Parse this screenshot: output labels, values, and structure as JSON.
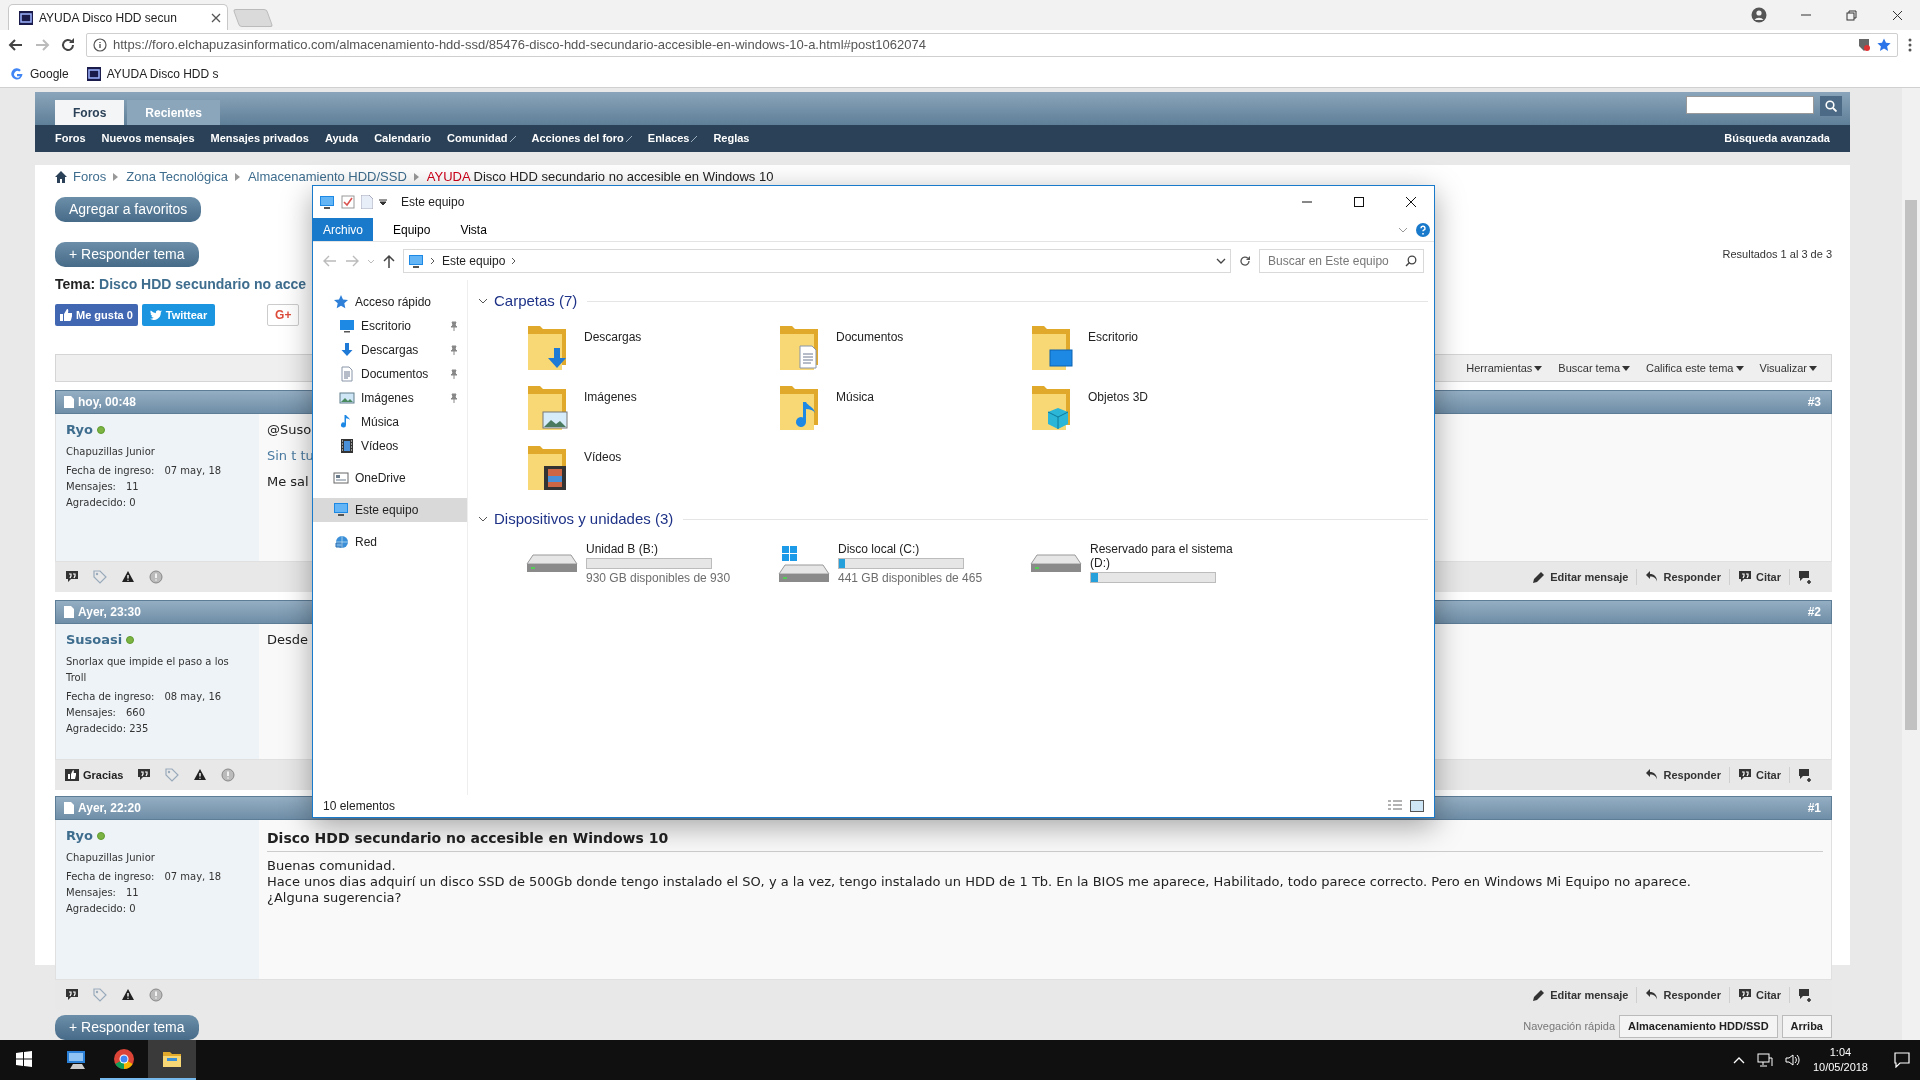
{
  "browser": {
    "tab_title": "AYUDA Disco HDD secun",
    "url": "https://foro.elchapuzasinformatico.com/almacenamiento-hdd-ssd/85476-disco-hdd-secundario-accesible-en-windows-10-a.html#post1062074",
    "bookmarks": [
      "Google",
      "AYUDA Disco HDD s"
    ]
  },
  "forum": {
    "tabs": [
      {
        "label": "Foros",
        "selected": true
      },
      {
        "label": "Recientes",
        "selected": false
      }
    ],
    "menu": [
      {
        "label": "Foros",
        "dropdown": false
      },
      {
        "label": "Nuevos mensajes",
        "dropdown": false
      },
      {
        "label": "Mensajes privados",
        "dropdown": false
      },
      {
        "label": "Ayuda",
        "dropdown": false
      },
      {
        "label": "Calendario",
        "dropdown": false
      },
      {
        "label": "Comunidad",
        "dropdown": true
      },
      {
        "label": "Acciones del foro",
        "dropdown": true
      },
      {
        "label": "Enlaces",
        "dropdown": true
      },
      {
        "label": "Reglas",
        "dropdown": false
      }
    ],
    "advanced_search": "Búsqueda avanzada",
    "breadcrumb": [
      "Foros",
      "Zona Tecnológica",
      "Almacenamiento HDD/SSD"
    ],
    "current": {
      "prefix": "AYUDA",
      "title": "Disco HDD secundario no accesible en Windows 10"
    },
    "favorites_button": "Agregar a favoritos",
    "reply_button": "+ Responder tema",
    "reply_button_bottom": "+ Responder tema",
    "results": "Resultados 1 al 3 de 3",
    "thread": {
      "label": "Tema:",
      "title": "Disco HDD secundario no acce"
    },
    "social": {
      "like": "Me gusta 0",
      "tweet": "Twittear",
      "gplus": "G+"
    },
    "tools": [
      "Herramientas",
      "Buscar tema",
      "Califica este tema",
      "Visualizar"
    ],
    "posts": [
      {
        "date": "hoy, 00:48",
        "number": "#3",
        "user": "Ryo",
        "online": true,
        "rank": "Chapuzillas Junior",
        "fields": [
          {
            "label": "Fecha de ingreso:",
            "value": "07 may, 18"
          },
          {
            "label": "Mensajes:",
            "value": "11"
          }
        ],
        "thanked": "Agradecido: 0",
        "lines": [
          {
            "kind": "plain",
            "text": "@Suso"
          },
          {
            "kind": "accent",
            "text": "Sin t tu"
          },
          {
            "kind": "plain",
            "text": "Me sal"
          }
        ],
        "actions": [
          {
            "kind": "edit",
            "label": "Editar mensaje"
          },
          {
            "kind": "reply",
            "label": "Responder"
          },
          {
            "kind": "quote",
            "label": "Citar"
          },
          {
            "kind": "multiquote"
          }
        ]
      },
      {
        "date": "Ayer, 23:30",
        "number": "#2",
        "user": "Susoasi",
        "online": true,
        "rank": "Snorlax que impide el paso a los Troll",
        "fields": [
          {
            "label": "Fecha de ingreso:",
            "value": "08 may, 16"
          },
          {
            "label": "Mensajes:",
            "value": "660"
          }
        ],
        "thanked": "Agradecido: 235",
        "thanks": "Gracias",
        "lines": [
          {
            "kind": "plain",
            "text": "Desde"
          }
        ],
        "actions": [
          {
            "kind": "reply",
            "label": "Responder"
          },
          {
            "kind": "quote",
            "label": "Citar"
          },
          {
            "kind": "multiquote"
          }
        ]
      },
      {
        "date": "Ayer, 22:20",
        "number": "#1",
        "user": "Ryo",
        "online": true,
        "rank": "Chapuzillas Junior",
        "fields": [
          {
            "label": "Fecha de ingreso:",
            "value": "07 may, 18"
          },
          {
            "label": "Mensajes:",
            "value": "11"
          }
        ],
        "thanked": "Agradecido: 0",
        "title": "Disco HDD secundario no accesible en Windows 10",
        "lines": [
          {
            "kind": "plain",
            "text": "Buenas comunidad."
          },
          {
            "kind": "plain",
            "text": "Hace unos dias adquirí un disco SSD de 500Gb donde tengo instalado el SO, y a la vez, tengo instalado un HDD de 1 Tb. En la BIOS me aparece, Habilitado, todo parece correcto. Pero en Windows Mi Equipo no aparece."
          },
          {
            "kind": "plain",
            "text": "¿Alguna sugerencia?"
          }
        ],
        "actions": [
          {
            "kind": "edit",
            "label": "Editar mensaje"
          },
          {
            "kind": "reply",
            "label": "Responder"
          },
          {
            "kind": "quote",
            "label": "Citar"
          },
          {
            "kind": "multiquote"
          }
        ]
      }
    ],
    "quick_nav": {
      "label": "Navegación rápida",
      "forum": "Almacenamiento HDD/SSD",
      "top": "Arriba"
    }
  },
  "explorer": {
    "title": "Este equipo",
    "ribbon_tabs": [
      {
        "label": "Archivo",
        "selected": true
      },
      {
        "label": "Equipo",
        "selected": false
      },
      {
        "label": "Vista",
        "selected": false
      }
    ],
    "address": "Este equipo",
    "search": {
      "placeholder": "Buscar en Este equipo"
    },
    "nav": [
      {
        "label": "Acceso rápido",
        "selected": false,
        "children": [
          {
            "label": "Escritorio",
            "pinned": true,
            "selected": false
          },
          {
            "label": "Descargas",
            "pinned": true,
            "selected": false
          },
          {
            "label": "Documentos",
            "pinned": true,
            "selected": false
          },
          {
            "label": "Imágenes",
            "pinned": true,
            "selected": false
          },
          {
            "label": "Música",
            "pinned": false,
            "selected": false
          },
          {
            "label": "Vídeos",
            "pinned": false,
            "selected": false
          }
        ]
      },
      {
        "label": "OneDrive",
        "selected": false
      },
      {
        "label": "Este equipo",
        "selected": true
      },
      {
        "label": "Red",
        "selected": false
      }
    ],
    "sections": [
      {
        "kind": "folders",
        "title": "Carpetas (7)",
        "expanded": true,
        "items": [
          {
            "label": "Descargas"
          },
          {
            "label": "Documentos"
          },
          {
            "label": "Escritorio"
          },
          {
            "label": "Imágenes"
          },
          {
            "label": "Música"
          },
          {
            "label": "Objetos 3D"
          },
          {
            "label": "Vídeos"
          }
        ]
      },
      {
        "kind": "drives",
        "title": "Dispositivos y unidades (3)",
        "expanded": true,
        "items": [
          {
            "label": "Unidad B (B:)",
            "system": false,
            "level": 0,
            "free": "930 GB disponibles de 930"
          },
          {
            "label": "Disco local (C:)",
            "system": true,
            "level": 0.05,
            "free": "441 GB disponibles de 465"
          },
          {
            "label": "Reservado para el sistema (D:)",
            "system": false,
            "level": 0.06
          }
        ]
      }
    ],
    "status": "10 elementos"
  },
  "taskbar": {
    "apps": [
      {
        "kind": "computer",
        "running": false,
        "active": false
      },
      {
        "kind": "chrome",
        "running": true,
        "active": false
      },
      {
        "kind": "explorer",
        "running": true,
        "active": true
      }
    ],
    "time": "1:04",
    "date": "10/05/2018"
  }
}
